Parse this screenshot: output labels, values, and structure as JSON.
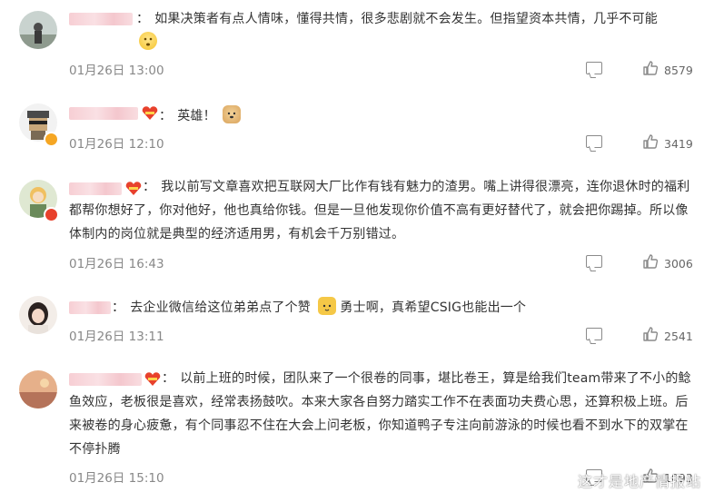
{
  "comments": [
    {
      "separator": "：",
      "text": "如果决策者有点人情味，懂得共情，很多悲剧就不会发生。但指望资本共情，几乎不可能",
      "emoji": "face-emoji",
      "time": "01月26日 13:00",
      "likes": "8579"
    },
    {
      "separator": "：",
      "text": "英雄！",
      "emoji": "doge-emoji",
      "time": "01月26日 12:10",
      "likes": "3419"
    },
    {
      "separator": "：",
      "text": "我以前写文章喜欢把互联网大厂比作有钱有魅力的渣男。嘴上讲得很漂亮，连你退休时的福利都帮你想好了，你对他好，他也真给你钱。但是一旦他发现你价值不高有更好替代了，就会把你踢掉。所以像体制内的岗位就是典型的经济适用男，有机会千万别错过。",
      "time": "01月26日 16:43",
      "likes": "3006"
    },
    {
      "separator": "：",
      "text_before": "去企业微信给这位弟弟点了个赞",
      "text_after": "勇士啊，真希望CSIG也能出一个",
      "emoji": "cat-emoji",
      "time": "01月26日 13:11",
      "likes": "2541"
    },
    {
      "separator": "：",
      "text": "以前上班的时候，团队来了一个很卷的同事，堪比卷王，算是给我们team带来了不小的鲶鱼效应，老板很是喜欢，经常表扬鼓吹。本来大家各自努力踏实工作不在表面功夫费心思，还算积极上班。后来被卷的身心疲惫，有个同事忍不住在大会上问老板，你知道鸭子专注向前游泳的时候也看不到水下的双掌在不停扑腾",
      "time": "01月26日 15:10",
      "likes": "1093"
    }
  ],
  "watermark": "这才是地产情报站",
  "colors": {
    "time": "#888888",
    "text": "#333333",
    "icon": "#8a8a8a",
    "vip_badge": "#e8412c",
    "verified_badge": "#f5a623"
  }
}
